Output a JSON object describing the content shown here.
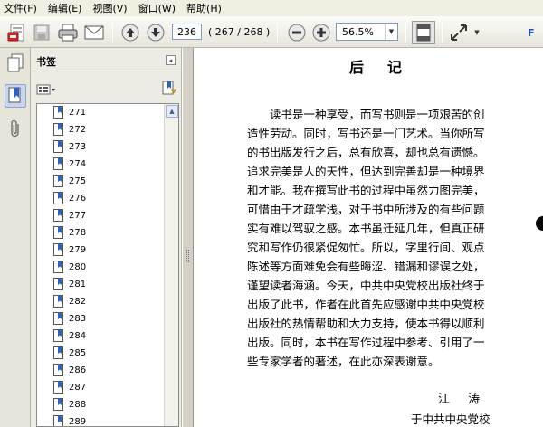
{
  "menubar": {
    "items": [
      "文件(F)",
      "编辑(E)",
      "视图(V)",
      "窗口(W)",
      "帮助(H)"
    ]
  },
  "toolbar": {
    "page_number": "236",
    "page_count": "( 267 / 268 )",
    "zoom": "56.5%",
    "right_truncated_label": "F",
    "icons": [
      "create-pdf-icon",
      "save-icon",
      "print-icon",
      "email-icon",
      "previous-page-icon",
      "next-page-icon",
      "zoom-out-icon",
      "zoom-in-icon",
      "fit-page-icon",
      "full-screen-icon"
    ]
  },
  "nav_panel": {
    "icons": [
      "pages-icon",
      "bookmarks-icon",
      "attachments-icon"
    ]
  },
  "bookmarks": {
    "title": "书签",
    "items": [
      "271",
      "272",
      "273",
      "274",
      "275",
      "276",
      "277",
      "278",
      "279",
      "280",
      "281",
      "282",
      "283",
      "284",
      "285",
      "286",
      "287",
      "288",
      "289"
    ]
  },
  "document": {
    "title": "后记",
    "lines": [
      "读书是一种享受，而写书则是一项艰苦的创",
      "造性劳动。同时，写书还是一门艺术。当你所写",
      "的书出版发行之后，总有欣喜，却也总有遗憾。",
      "追求完美是人的天性，但达到完善却是一种境界",
      "和才能。我在撰写此书的过程中虽然力图完美，",
      "可惜由于才疏学浅，对于书中所涉及的有些问题",
      "实有难以驾驭之感。本书虽迁延几年，但真正研",
      "究和写作仍很紧促匆忙。所以，字里行间、观点",
      "陈述等方面难免会有些晦涩、错漏和谬误之处，",
      "谨望读者海涵。今天，中共中央党校出版社终于",
      "出版了此书，作者在此首先应感谢中共中央党校",
      "出版社的热情帮助和大力支持，使本书得以顺利",
      "出版。同时，本书在写作过程中参考、引用了一",
      "些专家学者的著述，在此亦深表谢意。"
    ],
    "signature_name": "江 涛",
    "signature_place": "于中共中央党校"
  }
}
